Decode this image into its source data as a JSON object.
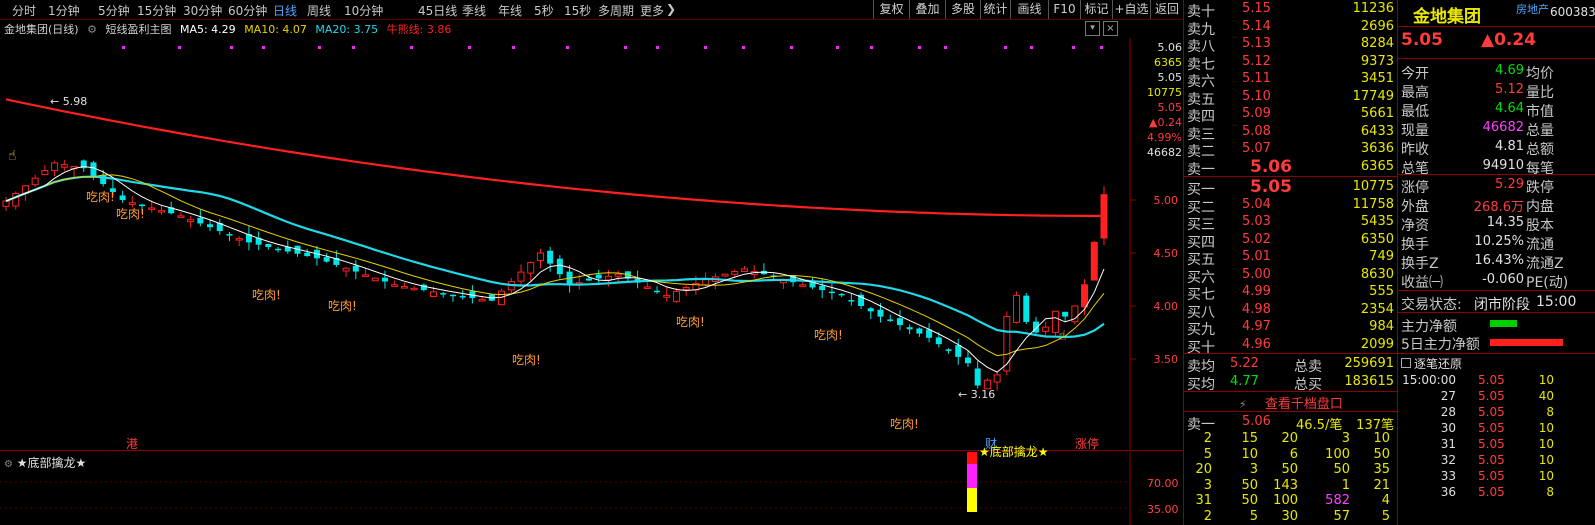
{
  "toolbar": {
    "periods": [
      "分时",
      "1分钟",
      "5分钟",
      "15分钟",
      "30分钟",
      "60分钟",
      "日线",
      "周线",
      "10分钟",
      "45日线",
      "季线",
      "年线",
      "5秒",
      "15秒",
      "多周期",
      "更多"
    ],
    "active_period": "日线",
    "more_arrow": "❯",
    "buttons": [
      "复权",
      "叠加",
      "多股",
      "统计",
      "画线",
      "F10",
      "标记",
      "+自选",
      "返回"
    ]
  },
  "chart_header": {
    "stock": "金地集团(日线)",
    "indicator": "短线盈利主图",
    "ma5": "MA5: 4.29",
    "ma10": "MA10: 4.07",
    "ma20": "MA20: 3.75",
    "bull_bear": "牛熊线: 3.86"
  },
  "chart": {
    "price_ticks": [
      "5.00",
      "4.50",
      "4.00",
      "3.50"
    ],
    "cursor_readout": [
      "5.06",
      "6365",
      "5.05",
      "10775",
      "5.05",
      "▲0.24",
      "4.99%",
      "46682"
    ],
    "high_label": "5.98",
    "low_label": "3.16",
    "signal_label": "吃肉!",
    "markers": [
      "港",
      "财",
      "涨停"
    ],
    "colors": {
      "up": "#ff2020",
      "down": "#00e5e5",
      "ma5": "#ffffff",
      "ma10": "#e8d000",
      "ma20": "#20d8e8",
      "bull_bear": "#ff2020"
    }
  },
  "sub_chart": {
    "title": "★底部擒龙★",
    "signal_label": "★底部擒龙★",
    "ticks": [
      "70.00",
      "35.00"
    ]
  },
  "order_book": {
    "asks": [
      {
        "label": "卖十",
        "price": "5.15",
        "vol": "11236"
      },
      {
        "label": "卖九",
        "price": "5.14",
        "vol": "2696"
      },
      {
        "label": "卖八",
        "price": "5.13",
        "vol": "8284"
      },
      {
        "label": "卖七",
        "price": "5.12",
        "vol": "9373"
      },
      {
        "label": "卖六",
        "price": "5.11",
        "vol": "3451"
      },
      {
        "label": "卖五",
        "price": "5.10",
        "vol": "17749"
      },
      {
        "label": "卖四",
        "price": "5.09",
        "vol": "5661"
      },
      {
        "label": "卖三",
        "price": "5.08",
        "vol": "6433"
      },
      {
        "label": "卖二",
        "price": "5.07",
        "vol": "3636"
      },
      {
        "label": "卖一",
        "price": "5.06",
        "vol": "6365"
      }
    ],
    "bids": [
      {
        "label": "买一",
        "price": "5.05",
        "vol": "10775"
      },
      {
        "label": "买二",
        "price": "5.04",
        "vol": "11758"
      },
      {
        "label": "买三",
        "price": "5.03",
        "vol": "5435"
      },
      {
        "label": "买四",
        "price": "5.02",
        "vol": "6350"
      },
      {
        "label": "买五",
        "price": "5.01",
        "vol": "749"
      },
      {
        "label": "买六",
        "price": "5.00",
        "vol": "8630"
      },
      {
        "label": "买七",
        "price": "4.99",
        "vol": "555"
      },
      {
        "label": "买八",
        "price": "4.98",
        "vol": "2354"
      },
      {
        "label": "买九",
        "price": "4.97",
        "vol": "984"
      },
      {
        "label": "买十",
        "price": "4.96",
        "vol": "2099"
      }
    ],
    "avg_ask_label": "卖均",
    "avg_ask": "5.22",
    "total_ask_label": "总卖",
    "total_ask": "259691",
    "avg_bid_label": "买均",
    "avg_bid": "4.77",
    "total_bid_label": "总买",
    "total_bid": "183615",
    "level1000_link": "查看千档盘口",
    "queue_label": "卖一",
    "queue_price": "5.06",
    "queue_avg": "46.5/笔",
    "queue_count": "137笔",
    "queue_rows": [
      [
        "2",
        "15",
        "20",
        "3",
        "10"
      ],
      [
        "5",
        "10",
        "6",
        "100",
        "50"
      ],
      [
        "20",
        "3",
        "50",
        "50",
        "35"
      ],
      [
        "3",
        "50",
        "143",
        "1",
        "21"
      ],
      [
        "31",
        "50",
        "100",
        "582",
        "4"
      ],
      [
        "2",
        "5",
        "30",
        "57",
        "5"
      ]
    ]
  },
  "info": {
    "name": "金地集团",
    "sector": "房地产",
    "code": "600383",
    "price": "5.05",
    "change": "▲0.24",
    "rows": [
      {
        "l1": "今开",
        "v1": "4.69",
        "c1": "green",
        "l2": "均价",
        "v2": ""
      },
      {
        "l1": "最高",
        "v1": "5.12",
        "c1": "red",
        "l2": "量比",
        "v2": ""
      },
      {
        "l1": "最低",
        "v1": "4.64",
        "c1": "green",
        "l2": "市值",
        "v2": ""
      },
      {
        "l1": "现量",
        "v1": "46682",
        "c1": "magenta",
        "l2": "总量",
        "v2": ""
      },
      {
        "l1": "昨收",
        "v1": "4.81",
        "c1": "white",
        "l2": "总额",
        "v2": ""
      },
      {
        "l1": "总笔",
        "v1": "94910",
        "c1": "white",
        "l2": "每笔",
        "v2": ""
      },
      {
        "l1": "涨停",
        "v1": "5.29",
        "c1": "red",
        "l2": "跌停",
        "v2": ""
      },
      {
        "l1": "外盘",
        "v1": "268.6万",
        "c1": "red",
        "l2": "内盘",
        "v2": ""
      },
      {
        "l1": "净资",
        "v1": "14.35",
        "c1": "white",
        "l2": "股本",
        "v2": ""
      },
      {
        "l1": "换手",
        "v1": "10.25%",
        "c1": "white",
        "l2": "流通",
        "v2": ""
      },
      {
        "l1": "换手Z",
        "v1": "16.43%",
        "c1": "white",
        "l2": "流通Z",
        "v2": ""
      },
      {
        "l1": "收益㈠",
        "v1": "-0.060",
        "c1": "white",
        "l2": "PE(动)",
        "v2": ""
      }
    ],
    "trade_status_label": "交易状态:",
    "trade_status": "闭市阶段",
    "trade_time": "15:00",
    "main_net_label": "主力净额",
    "main_net_5d_label": "5日主力净额",
    "tick_title": "逐笔还原",
    "ticks": [
      {
        "t": "15:00:00",
        "p": "5.05",
        "v": "10"
      },
      {
        "t": "27",
        "p": "5.05",
        "v": "40"
      },
      {
        "t": "28",
        "p": "5.05",
        "v": "8"
      },
      {
        "t": "30",
        "p": "5.05",
        "v": "10"
      },
      {
        "t": "31",
        "p": "5.05",
        "v": "10"
      },
      {
        "t": "32",
        "p": "5.05",
        "v": "10"
      },
      {
        "t": "33",
        "p": "5.05",
        "v": "10"
      },
      {
        "t": "36",
        "p": "5.05",
        "v": "8"
      }
    ]
  }
}
